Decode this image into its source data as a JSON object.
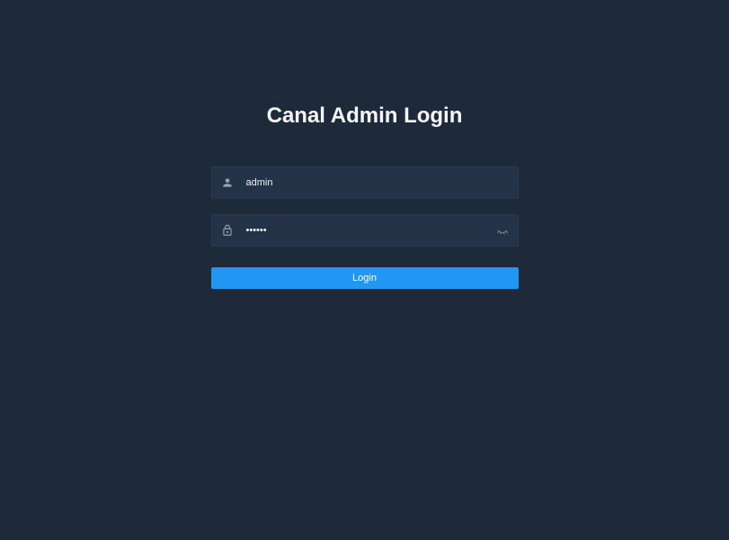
{
  "login": {
    "title": "Canal Admin Login",
    "username_value": "admin",
    "username_placeholder": "",
    "password_value": "••••••",
    "password_placeholder": "",
    "button_label": "Login"
  }
}
